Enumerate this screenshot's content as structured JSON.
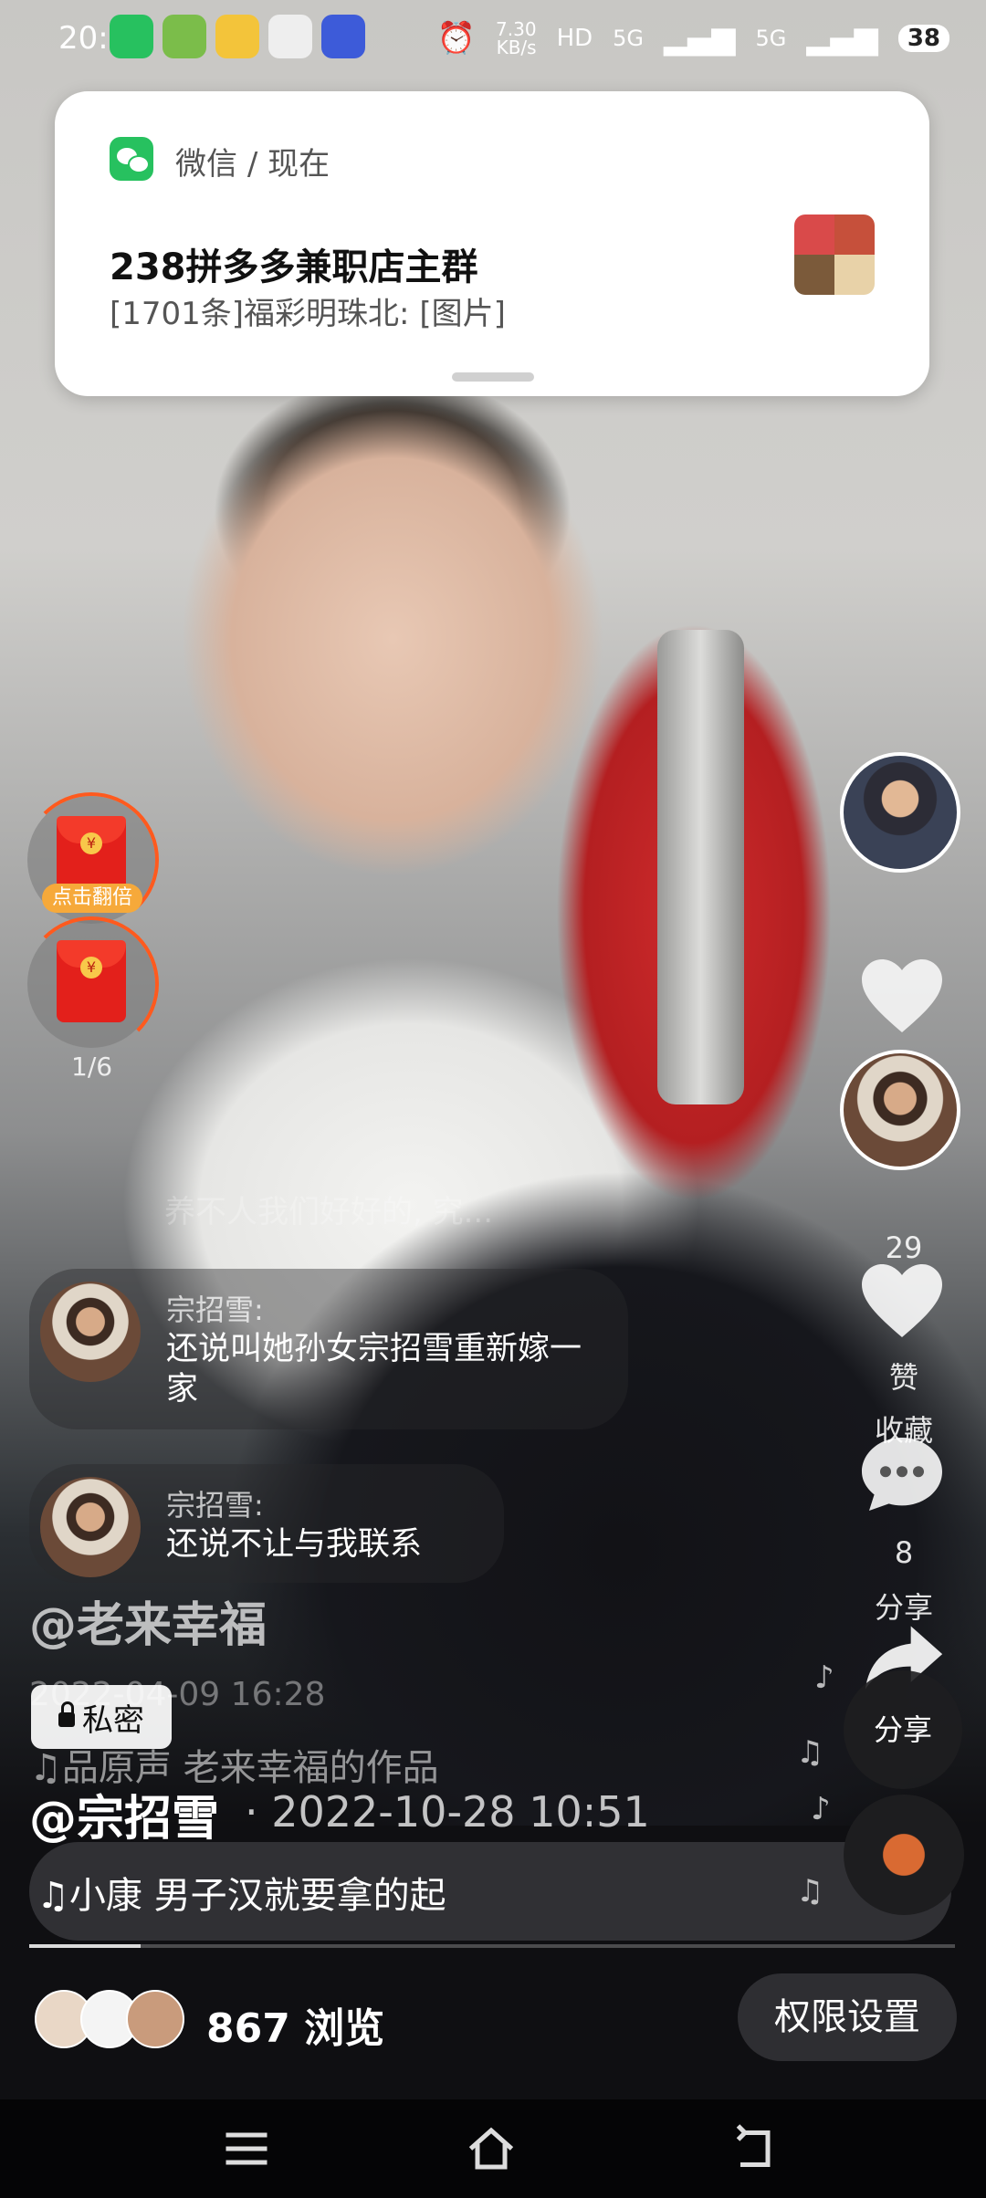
{
  "status_bar": {
    "time": "20:14",
    "speed_top": "7.30",
    "speed_unit": "KB/s",
    "net1": "5G",
    "net2": "5G",
    "battery": "38"
  },
  "notification": {
    "app": "微信",
    "sep": "/",
    "when": "现在",
    "title": "238拼多多兼职店主群",
    "body": "[1701条]福彩明珠北: [图片]"
  },
  "red_packets": {
    "tag_label": "点击翻倍",
    "pager": "1/6"
  },
  "right_rail": {
    "like_count_ghost": "29",
    "like_label": "赞",
    "collect_label": "收藏",
    "comment_count": "8",
    "share_label": "分享",
    "share_button_label": "分享"
  },
  "comments": [
    {
      "ghost": "养不人我们好好的, 究...",
      "name": "宗招雪:",
      "text": "还说叫她孙女宗招雪重新嫁一家"
    },
    {
      "name": "宗招雪:",
      "text": "还说不让与我联系"
    }
  ],
  "video_info": {
    "user_handle_ghost": "@老来幸福",
    "date_ghost": "2022-04-09 16:28",
    "privacy_label": "私密",
    "music_ghost": "♫品原声    老来幸福的作品",
    "author": "@宗招雪",
    "author_date": "· 2022-10-28 10:51",
    "music": "♫小康    男子汉就要拿的起"
  },
  "bottom": {
    "views_count": "867",
    "views_label": "浏览",
    "permission_button": "权限设置",
    "progress": 0.12
  }
}
